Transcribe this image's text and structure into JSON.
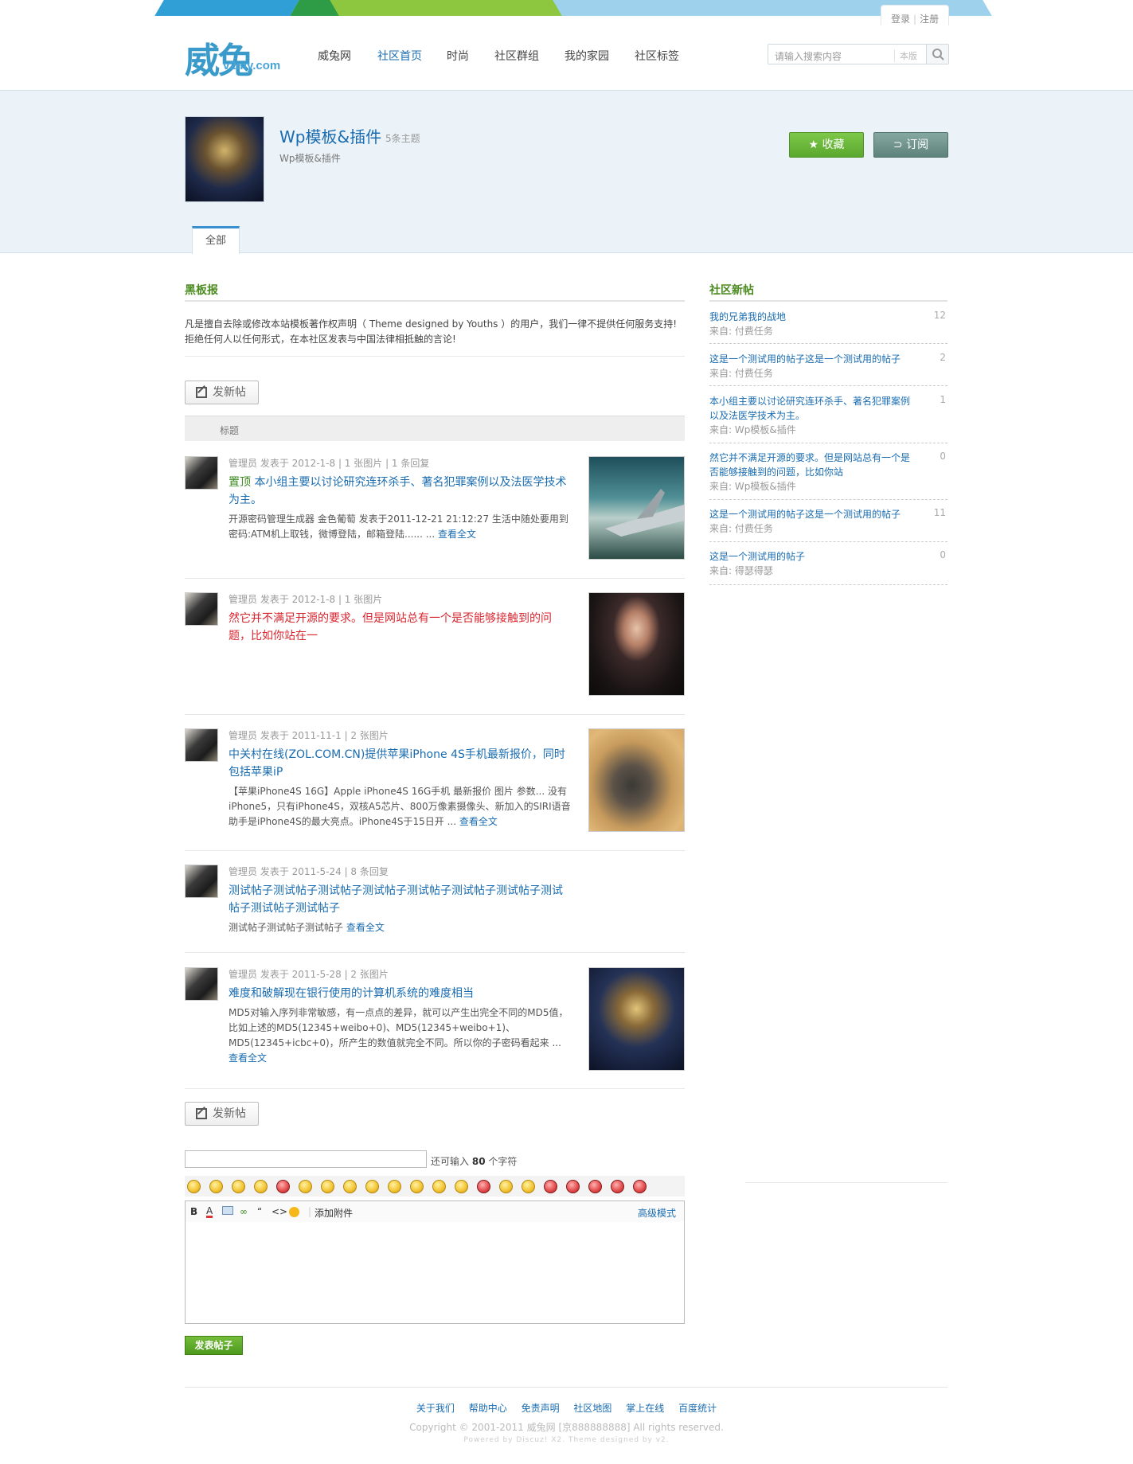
{
  "site": {
    "logo_cn": "威兔",
    "logo_en": "v2my.com",
    "login": "登录",
    "register": "注册",
    "nav": [
      "威兔网",
      "社区首页",
      "时尚",
      "社区群组",
      "我的家园",
      "社区标签"
    ],
    "nav_active": "社区首页",
    "search_placeholder": "请输入搜索内容",
    "search_scope": "本版"
  },
  "group": {
    "title": "Wp模板&插件",
    "topic_count": "5条主题",
    "description": "Wp模板&插件",
    "fav_label": "收藏",
    "subscribe_label": "订阅",
    "tab_all": "全部"
  },
  "blackboard": {
    "title": "黑板报",
    "line1": "凡是擅自去除或修改本站模板著作权声明（ Theme designed by Youths ）的用户，我们一律不提供任何服务支持!",
    "line2": "拒绝任何人以任何形式，在本社区发表与中国法律相抵触的言论!"
  },
  "list": {
    "new_post_label": "发新帖",
    "header_title": "标题",
    "posts": [
      {
        "author": "管理员",
        "meta": "发表于 2012-1-8 | 1 张图片 | 1 条回复",
        "sticky": "置顶",
        "title": "本小组主要以讨论研究连环杀手、著名犯罪案例以及法医学技术为主。",
        "excerpt": "开源密码管理生成器 金色葡萄 发表于2011-12-21 21:12:27 生活中随处要用到密码:ATM机上取钱，微博登陆，邮箱登陆...... ...",
        "read_more": "查看全文",
        "thumb": "plane"
      },
      {
        "author": "管理员",
        "meta": "发表于 2012-1-8 | 1 张图片",
        "title": "然它并不满足开源的要求。但是网站总有一个是否能够接触到的问题，比如你站在一",
        "thumb": "girl"
      },
      {
        "author": "管理员",
        "meta": "发表于 2011-11-1 | 2 张图片",
        "title": "中关村在线(ZOL.COM.CN)提供苹果iPhone 4S手机最新报价，同时包括苹果iP",
        "excerpt": "【苹果iPhone4S 16G】Apple iPhone4S 16G手机 最新报价 图片 参数... 没有iPhone5，只有iPhone4S，双核A5芯片、800万像素摄像头、新加入的SIRI语音助手是iPhone4S的最大亮点。iPhone4S于15日开 ...",
        "read_more": "查看全文",
        "thumb": "robot"
      },
      {
        "author": "管理员",
        "meta": "发表于 2011-5-24 | 8 条回复",
        "title": "测试帖子测试帖子测试帖子测试帖子测试帖子测试帖子测试帖子测试帖子测试帖子测试帖子",
        "excerpt": "测试帖子测试帖子测试帖子",
        "read_more": "查看全文"
      },
      {
        "author": "管理员",
        "meta": "发表于 2011-5-28 | 2 张图片",
        "title": "难度和破解现在银行使用的计算机系统的难度相当",
        "excerpt": "MD5对输入序列非常敏感，有一点点的差异，就可以产生出完全不同的MD5值，比如上述的MD5(12345+weibo+0)、MD5(12345+weibo+1)、MD5(12345+icbc+0)，所产生的数值就完全不同。所以你的子密码看起来 ...",
        "read_more": "查看全文",
        "thumb": "warrior"
      }
    ]
  },
  "sidebar": {
    "title": "社区新帖",
    "items": [
      {
        "title": "我的兄弟我的战地",
        "from": "来自: 付费任务",
        "count": "12"
      },
      {
        "title": "这是一个测试用的帖子这是一个测试用的帖子",
        "from": "来自: 付费任务",
        "count": "2"
      },
      {
        "title": "本小组主要以讨论研究连环杀手、著名犯罪案例以及法医学技术为主。",
        "from": "来自: Wp模板&插件",
        "count": "1"
      },
      {
        "title": "然它并不满足开源的要求。但是网站总有一个是否能够接触到的问题，比如你站",
        "from": "来自: Wp模板&插件",
        "count": "0"
      },
      {
        "title": "这是一个测试用的帖子这是一个测试用的帖子",
        "from": "来自: 付费任务",
        "count": "11"
      },
      {
        "title": "这是一个测试用的帖子",
        "from": "来自: 得瑟得瑟",
        "count": "0"
      }
    ]
  },
  "reply": {
    "remaining_prefix": "还可输入",
    "remaining_count": "80",
    "remaining_suffix": "个字符",
    "attach_label": "添加附件",
    "advanced_label": "高级模式",
    "submit_label": "发表帖子"
  },
  "footer": {
    "links": [
      "关于我们",
      "帮助中心",
      "免责声明",
      "社区地图",
      "掌上在线",
      "百度统计"
    ],
    "copyright": "Copyright © 2001-2011 威兔网 [京888888888] All rights reserved.",
    "powered": "Powered by Discuz! X2. Theme designed by v2."
  }
}
